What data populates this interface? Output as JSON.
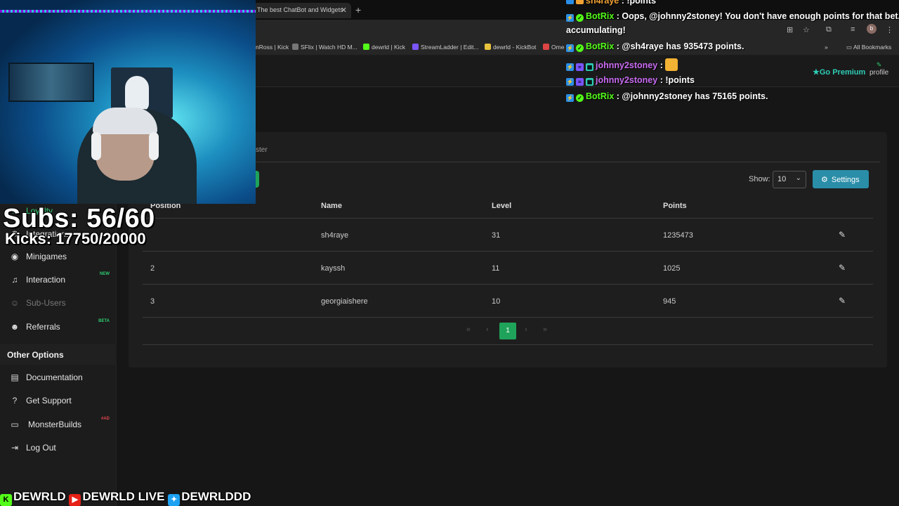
{
  "browser": {
    "active_tab": "The best ChatBot and Widgets",
    "tab_close": "✕",
    "new_tab": "+",
    "bookmarks": [
      {
        "label": "nRoss | Kick",
        "color": "#53fc18"
      },
      {
        "label": "SFlix | Watch HD M...",
        "color": "#777"
      },
      {
        "label": "dewrld | Kick",
        "color": "#53fc18"
      },
      {
        "label": "StreamLadder | Edit...",
        "color": "#7a55ff"
      },
      {
        "label": "dewrld - KickBot",
        "color": "#e8c33c"
      },
      {
        "label": "Ome",
        "color": "#d44"
      }
    ],
    "all_bookmarks": "All Bookmarks",
    "profile_initial": "b"
  },
  "header": {
    "go_premium": "Go Premium",
    "profile": "profile"
  },
  "sidebar": {
    "items": [
      {
        "label": "Loyalty",
        "icon": "star-icon",
        "glyph": "★"
      },
      {
        "label": "Integrations",
        "icon": "plug-icon",
        "glyph": "⚙"
      },
      {
        "label": "Minigames",
        "icon": "gamepad-icon",
        "glyph": "◉"
      },
      {
        "label": "Interaction",
        "icon": "music-icon",
        "glyph": "♫",
        "badge": "NEW"
      },
      {
        "label": "Sub-Users",
        "icon": "users-icon",
        "glyph": "☺",
        "disabled": true
      },
      {
        "label": "Referrals",
        "icon": "referrals-icon",
        "glyph": "☻",
        "badge": "BETA"
      }
    ],
    "other_options_heading": "Other Options",
    "other_items": [
      {
        "label": "Documentation",
        "icon": "book-icon",
        "glyph": "▤"
      },
      {
        "label": "Get Support",
        "icon": "question-icon",
        "glyph": "?"
      },
      {
        "label": "MonsterBuilds",
        "icon": "laptop-icon",
        "glyph": "▭",
        "badge": "#AD"
      },
      {
        "label": "Log Out",
        "icon": "logout-icon",
        "glyph": "⇥"
      }
    ]
  },
  "main": {
    "tab_label": "ster",
    "show_label": "Show:",
    "show_value": "10",
    "settings_label": "Settings",
    "columns": [
      "Position",
      "Name",
      "Level",
      "Points"
    ],
    "rows": [
      {
        "position": "",
        "name": "sh4raye",
        "level": "31",
        "points": "1235473"
      },
      {
        "position": "2",
        "name": "kayssh",
        "level": "11",
        "points": "1025"
      },
      {
        "position": "3",
        "name": "georgiaishere",
        "level": "10",
        "points": "945"
      }
    ],
    "pagination": {
      "first": "«",
      "prev": "‹",
      "current": "1",
      "next": "›",
      "last": "»"
    }
  },
  "overlay": {
    "subs": "Subs: 56/60",
    "kicks": "Kicks: 17750/20000",
    "socials": [
      "DEWRLD",
      "DEWRLD LIVE",
      "DEWRLDDD"
    ]
  },
  "chat": [
    {
      "user": "sh4raye",
      "sep": " : ",
      "text": "!points",
      "kind": "user"
    },
    {
      "user": "BotRix",
      "sep": " : ",
      "text": "Oops, @johnny2stoney! You don't have enough points for that bet. K",
      "kind": "bot"
    },
    {
      "user": "",
      "sep": "",
      "text": "accumulating!",
      "kind": "cont"
    },
    {
      "user": "BotRix",
      "sep": " : ",
      "text": "@sh4raye has 935473 points.",
      "kind": "bot"
    },
    {
      "user": "johnny2stoney",
      "sep": " : ",
      "text": "",
      "kind": "user",
      "emote": true
    },
    {
      "user": "johnny2stoney",
      "sep": " : ",
      "text": "!points",
      "kind": "user"
    },
    {
      "user": "BotRix",
      "sep": " : ",
      "text": "@johnny2stoney has 75165 points.",
      "kind": "bot"
    }
  ]
}
